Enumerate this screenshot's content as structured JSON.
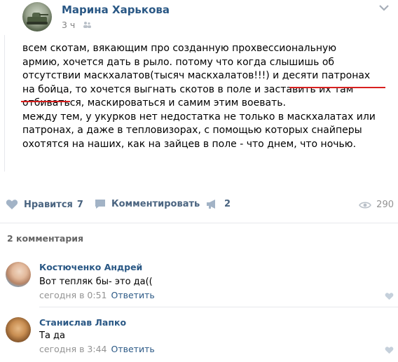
{
  "post": {
    "author": "Марина Харькова",
    "time": "3 ч",
    "lines": [
      "всем скотам, вякающим про созданную прохвессиональную",
      "армию, хочется дать в рыло. потому что когда слышишь об",
      "отсутствии маскхалатов(тысяч маскхалатов!!!) и десяти патронах",
      "на бойца, то хочется выгнать скотов в поле и заставить их там",
      "отбиваться, маскироваться и самим этим воевать.",
      "между тем, у укурков нет недостатка не только в маскхалатах или",
      "патронах, а даже в тепловизорах, с помощью которых снайперы",
      "охотятся на наших, как на зайцев в поле - что днем, что ночью."
    ],
    "icons": {
      "privacy": "people-icon",
      "menu": "chevron-down-icon"
    },
    "highlight_color": "#d8201f"
  },
  "actions": {
    "like_label": "Нравится",
    "like_count": "7",
    "comment_label": "Комментировать",
    "share_count": "2",
    "views_count": "290"
  },
  "comments_header": "2 комментария",
  "comments": [
    {
      "name": "Костюченко Андрей",
      "text": "Вот тепляк бы- это да((",
      "time": "сегодня в 0:51",
      "reply": "Ответить"
    },
    {
      "name": "Станислав Лапко",
      "text": "Та да",
      "time": "сегодня в 3:44",
      "reply": "Ответить"
    }
  ],
  "colors": {
    "link": "#2a5885",
    "action": "#4a6480",
    "muted": "#939393",
    "divider": "#e7e8ec"
  }
}
